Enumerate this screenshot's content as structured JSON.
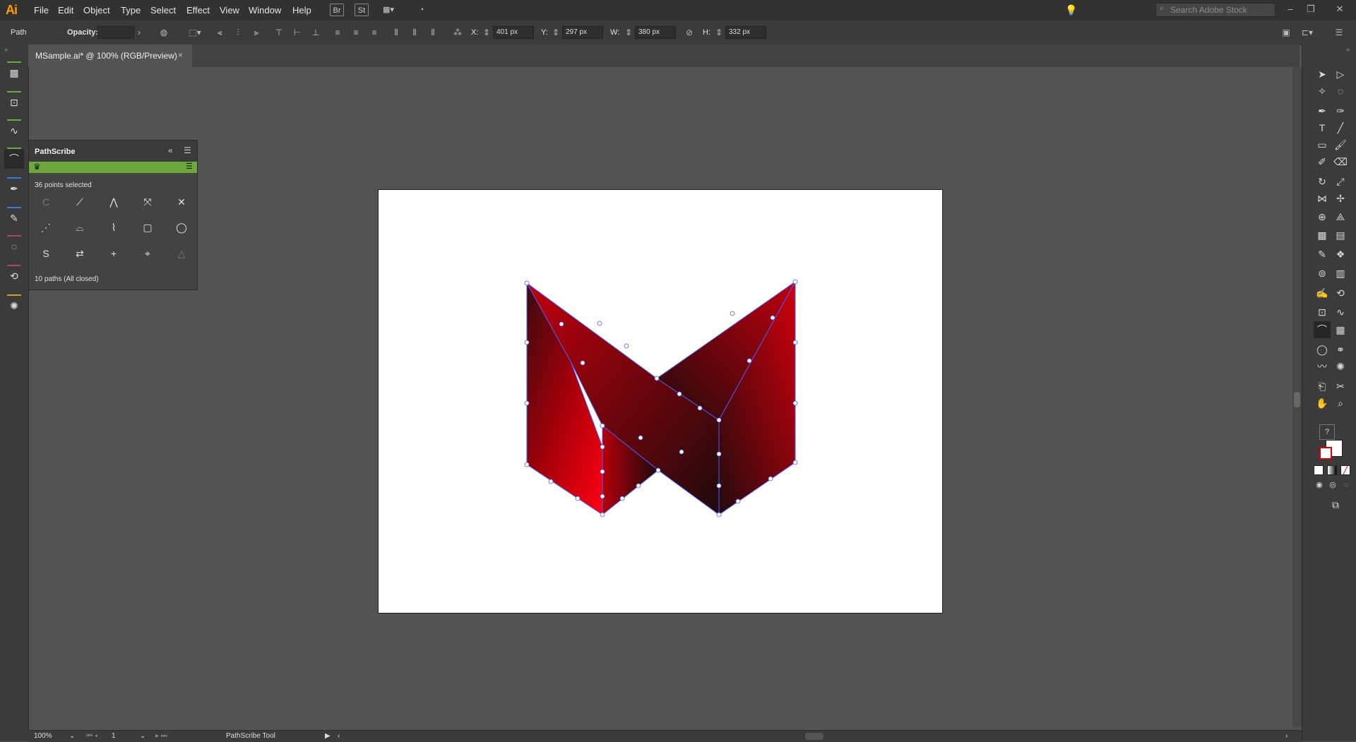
{
  "app": {
    "logo": "Ai"
  },
  "menu": [
    "File",
    "Edit",
    "Object",
    "Type",
    "Select",
    "Effect",
    "View",
    "Window",
    "Help"
  ],
  "menubar_icons": {
    "bridge": "Br",
    "stock": "St"
  },
  "search": {
    "placeholder": "Search Adobe Stock"
  },
  "control": {
    "selection_type": "Path",
    "opacity_label": "Opacity:",
    "x_label": "X:",
    "x_value": "401 px",
    "y_label": "Y:",
    "y_value": "297 px",
    "w_label": "W:",
    "w_value": "380 px",
    "h_label": "H:",
    "h_value": "332 px"
  },
  "document": {
    "tab_title": "MSample.ai* @ 100% (RGB/Preview)",
    "close": "×"
  },
  "pathscribe": {
    "title": "PathScribe",
    "points_selected": "36 points selected",
    "paths_info": "10 paths (All closed)",
    "buttons": [
      "smooth-icon",
      "line-icon",
      "corner-icon",
      "break-icon",
      "delete-icon",
      "straighten-icon",
      "fit-curve-icon",
      "simplify-icon",
      "close-path-icon",
      "round-icon",
      "s-curve-icon",
      "reverse-icon",
      "add-point-icon",
      "center-icon",
      "triangle-icon"
    ],
    "s_label": "S",
    "plus_label": "+"
  },
  "status": {
    "zoom": "100%",
    "artboard": "1",
    "tool": "PathScribe Tool"
  },
  "colors": {
    "accent_green": "#6ca83a",
    "art_red": "#e8000a",
    "art_dark": "#2b0a0c",
    "path_blue": "#4a5bff",
    "ui_dark": "#323232"
  }
}
